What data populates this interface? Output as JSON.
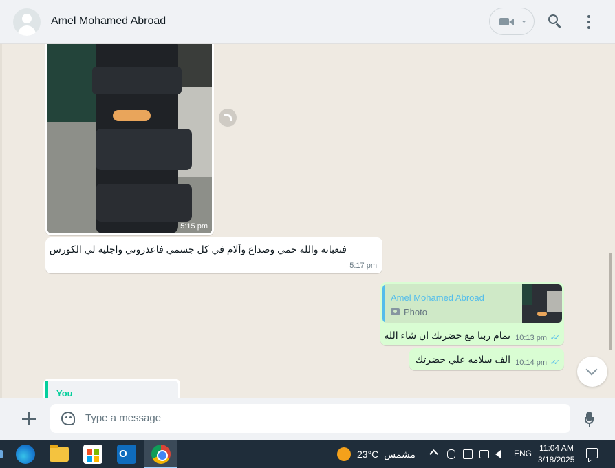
{
  "header": {
    "contact_name": "Amel Mohamed Abroad",
    "icons": [
      "avatar",
      "video-call-icon",
      "chevron-down-icon",
      "search-icon",
      "more-options-icon"
    ]
  },
  "messages": {
    "photo": {
      "time": "5:15 pm"
    },
    "incoming_text": {
      "text": "فتعبانه والله حمي وصداع وآلام في كل جسمي فاعذروني واجليه لي الكورس",
      "time": "5:17 pm"
    },
    "reply": {
      "quoted_name": "Amel Mohamed Abroad",
      "quoted_type": "Photo",
      "text": "تمام ربنا مع حضرتك ان شاء الله",
      "time": "10:13 pm",
      "ticks": "✓✓"
    },
    "outgoing_2": {
      "text": "الف سلامه علي حضرتك",
      "time": "10:14 pm",
      "ticks": "✓✓"
    },
    "partial": {
      "quoted_name": "You"
    }
  },
  "composer": {
    "placeholder": "Type a message"
  },
  "taskbar": {
    "weather_temp": "23°C",
    "weather_desc": "مشمس",
    "language": "ENG",
    "time": "11:04 AM",
    "date": "3/18/2025"
  },
  "colors": {
    "header_bg": "#f0f2f5",
    "chat_bg": "#efeae2",
    "outgoing_bubble": "#d9fdd3",
    "incoming_bubble": "#ffffff",
    "quote_name": "#53bdeb",
    "you_name": "#06cf9c",
    "taskbar_bg": "#1f2d3a"
  }
}
